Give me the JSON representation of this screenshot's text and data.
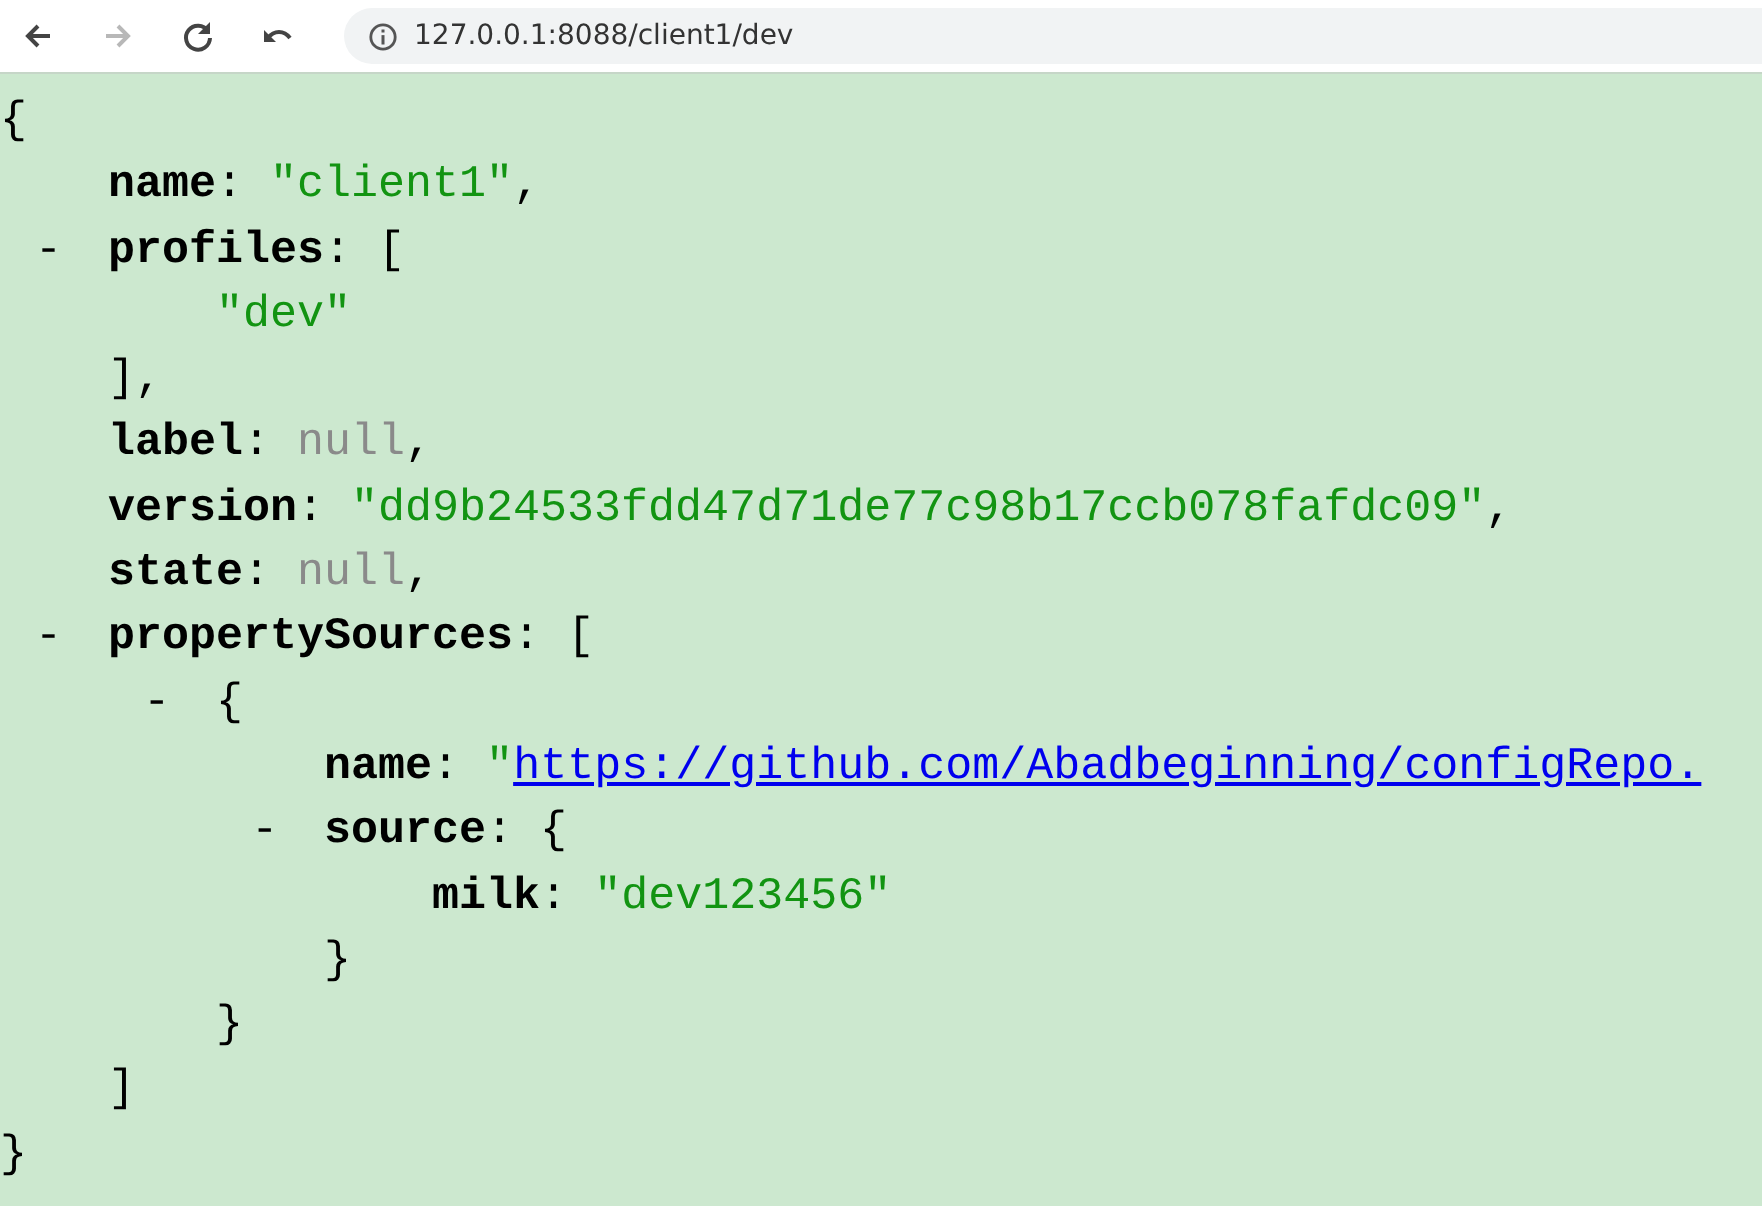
{
  "browser": {
    "nav": [
      {
        "kind": "back",
        "disabled": false
      },
      {
        "kind": "forward",
        "disabled": true
      },
      {
        "kind": "reload",
        "disabled": false
      },
      {
        "kind": "undo",
        "disabled": false
      }
    ],
    "address": "127.0.0.1:8088/client1/dev"
  },
  "document": {
    "open": "{",
    "close": "}",
    "children": [
      {
        "kind": "string",
        "key": "name",
        "sep": ":",
        "value": "\"client1\"",
        "tail": ","
      },
      {
        "kind": "block",
        "toggle": "-",
        "key": "profiles",
        "sep": ":",
        "open": "[",
        "close": "],",
        "children": [
          {
            "kind": "string",
            "value": "\"dev\""
          }
        ]
      },
      {
        "kind": "null",
        "key": "label",
        "sep": ":",
        "value": "null",
        "tail": ","
      },
      {
        "kind": "string",
        "key": "version",
        "sep": ":",
        "value": "\"dd9b24533fdd47d71de77c98b17ccb078fafdc09\"",
        "tail": ","
      },
      {
        "kind": "null",
        "key": "state",
        "sep": ":",
        "value": "null",
        "tail": ","
      },
      {
        "kind": "block",
        "toggle": "-",
        "key": "propertySources",
        "sep": ":",
        "open": "[",
        "close": "]",
        "children": [
          {
            "kind": "block",
            "toggle": "-",
            "open": "{",
            "close": "}",
            "children": [
              {
                "kind": "link",
                "key": "name",
                "sep": ":",
                "lead": "\"",
                "value": "https://github.com/Abadbeginning/configRepo."
              },
              {
                "kind": "block",
                "toggle": "-",
                "key": "source",
                "sep": ":",
                "open": "{",
                "close": "}",
                "children": [
                  {
                    "kind": "string",
                    "key": "milk",
                    "sep": ":",
                    "value": "\"dev123456\""
                  }
                ]
              }
            ]
          }
        ]
      }
    ]
  }
}
